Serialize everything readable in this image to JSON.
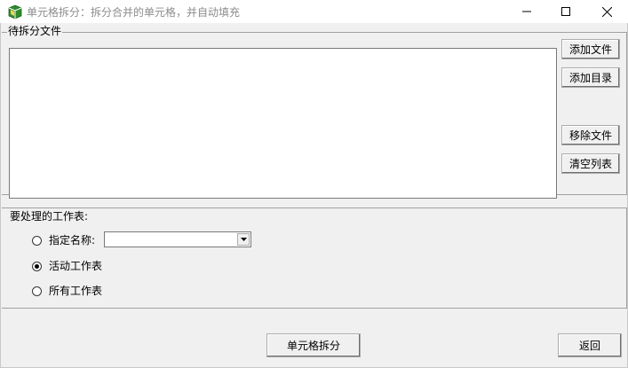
{
  "window": {
    "title": "单元格拆分：拆分合并的单元格，并自动填充",
    "icon": "book-icon"
  },
  "files_group": {
    "caption": "待拆分文件",
    "buttons": {
      "add_file": "添加文件",
      "add_dir": "添加目录",
      "remove_file": "移除文件",
      "clear_list": "清空列表"
    }
  },
  "sheets_group": {
    "label": "要处理的工作表:",
    "options": {
      "named": "指定名称:",
      "active": "活动工作表",
      "all": "所有工作表"
    },
    "selected": "active",
    "combo_value": ""
  },
  "footer": {
    "split_button": "单元格拆分",
    "back_button": "返回"
  }
}
